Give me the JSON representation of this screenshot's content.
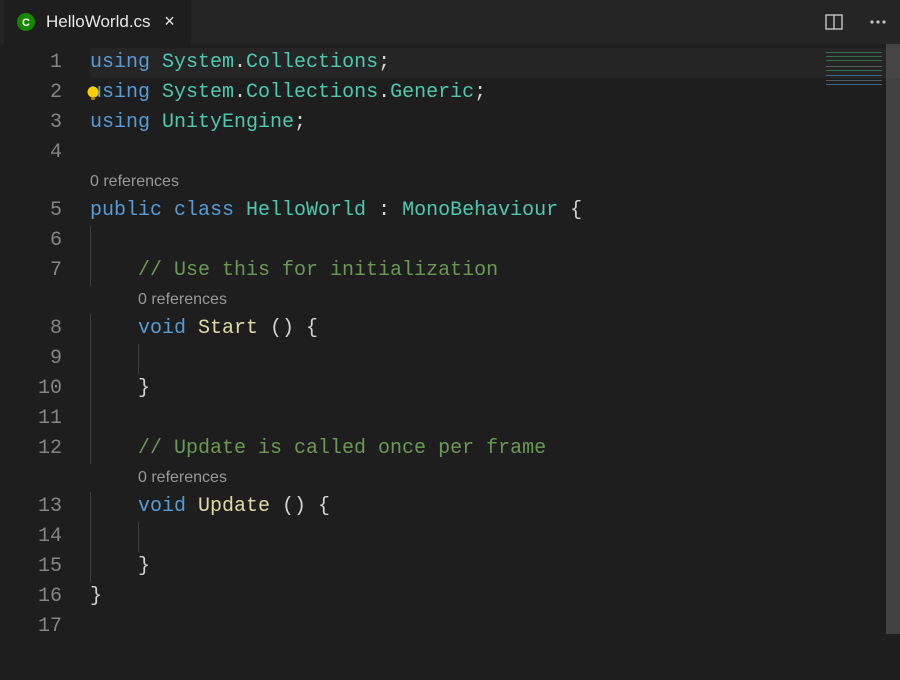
{
  "tab": {
    "filename": "HelloWorld.cs"
  },
  "codelens": {
    "class": "0 references",
    "start": "0 references",
    "update": "0 references"
  },
  "line_numbers": [
    "1",
    "2",
    "3",
    "4",
    "5",
    "6",
    "7",
    "8",
    "9",
    "10",
    "11",
    "12",
    "13",
    "14",
    "15",
    "16",
    "17"
  ],
  "lines": {
    "l1": [
      {
        "t": "using ",
        "c": "kw"
      },
      {
        "t": "System",
        "c": "type"
      },
      {
        "t": ".",
        "c": "pun"
      },
      {
        "t": "Collections",
        "c": "type"
      },
      {
        "t": ";",
        "c": "pun"
      }
    ],
    "l2": [
      {
        "t": "using ",
        "c": "kw"
      },
      {
        "t": "System",
        "c": "type"
      },
      {
        "t": ".",
        "c": "pun"
      },
      {
        "t": "Collections",
        "c": "type"
      },
      {
        "t": ".",
        "c": "pun"
      },
      {
        "t": "Generic",
        "c": "type"
      },
      {
        "t": ";",
        "c": "pun"
      }
    ],
    "l3": [
      {
        "t": "using ",
        "c": "kw"
      },
      {
        "t": "UnityEngine",
        "c": "type"
      },
      {
        "t": ";",
        "c": "pun"
      }
    ],
    "l4": [],
    "l5": [
      {
        "t": "public ",
        "c": "kw"
      },
      {
        "t": "class ",
        "c": "kw"
      },
      {
        "t": "HelloWorld",
        "c": "type"
      },
      {
        "t": " : ",
        "c": "pun"
      },
      {
        "t": "MonoBehaviour",
        "c": "type"
      },
      {
        "t": " {",
        "c": "pun"
      }
    ],
    "l6": [],
    "l7": [
      {
        "t": "    ",
        "c": "plain"
      },
      {
        "t": "// Use this for initialization",
        "c": "com"
      }
    ],
    "l8": [
      {
        "t": "    ",
        "c": "plain"
      },
      {
        "t": "void ",
        "c": "kw"
      },
      {
        "t": "Start",
        "c": "fn"
      },
      {
        "t": " () {",
        "c": "pun"
      }
    ],
    "l9": [],
    "l10": [
      {
        "t": "    }",
        "c": "pun"
      }
    ],
    "l11": [],
    "l12": [
      {
        "t": "    ",
        "c": "plain"
      },
      {
        "t": "// Update is called once per frame",
        "c": "com"
      }
    ],
    "l13": [
      {
        "t": "    ",
        "c": "plain"
      },
      {
        "t": "void ",
        "c": "kw"
      },
      {
        "t": "Update",
        "c": "fn"
      },
      {
        "t": " () {",
        "c": "pun"
      }
    ],
    "l14": [],
    "l15": [
      {
        "t": "    }",
        "c": "pun"
      }
    ],
    "l16": [
      {
        "t": "}",
        "c": "pun"
      }
    ],
    "l17": []
  },
  "lightbulb_line": 2,
  "current_line": 1
}
